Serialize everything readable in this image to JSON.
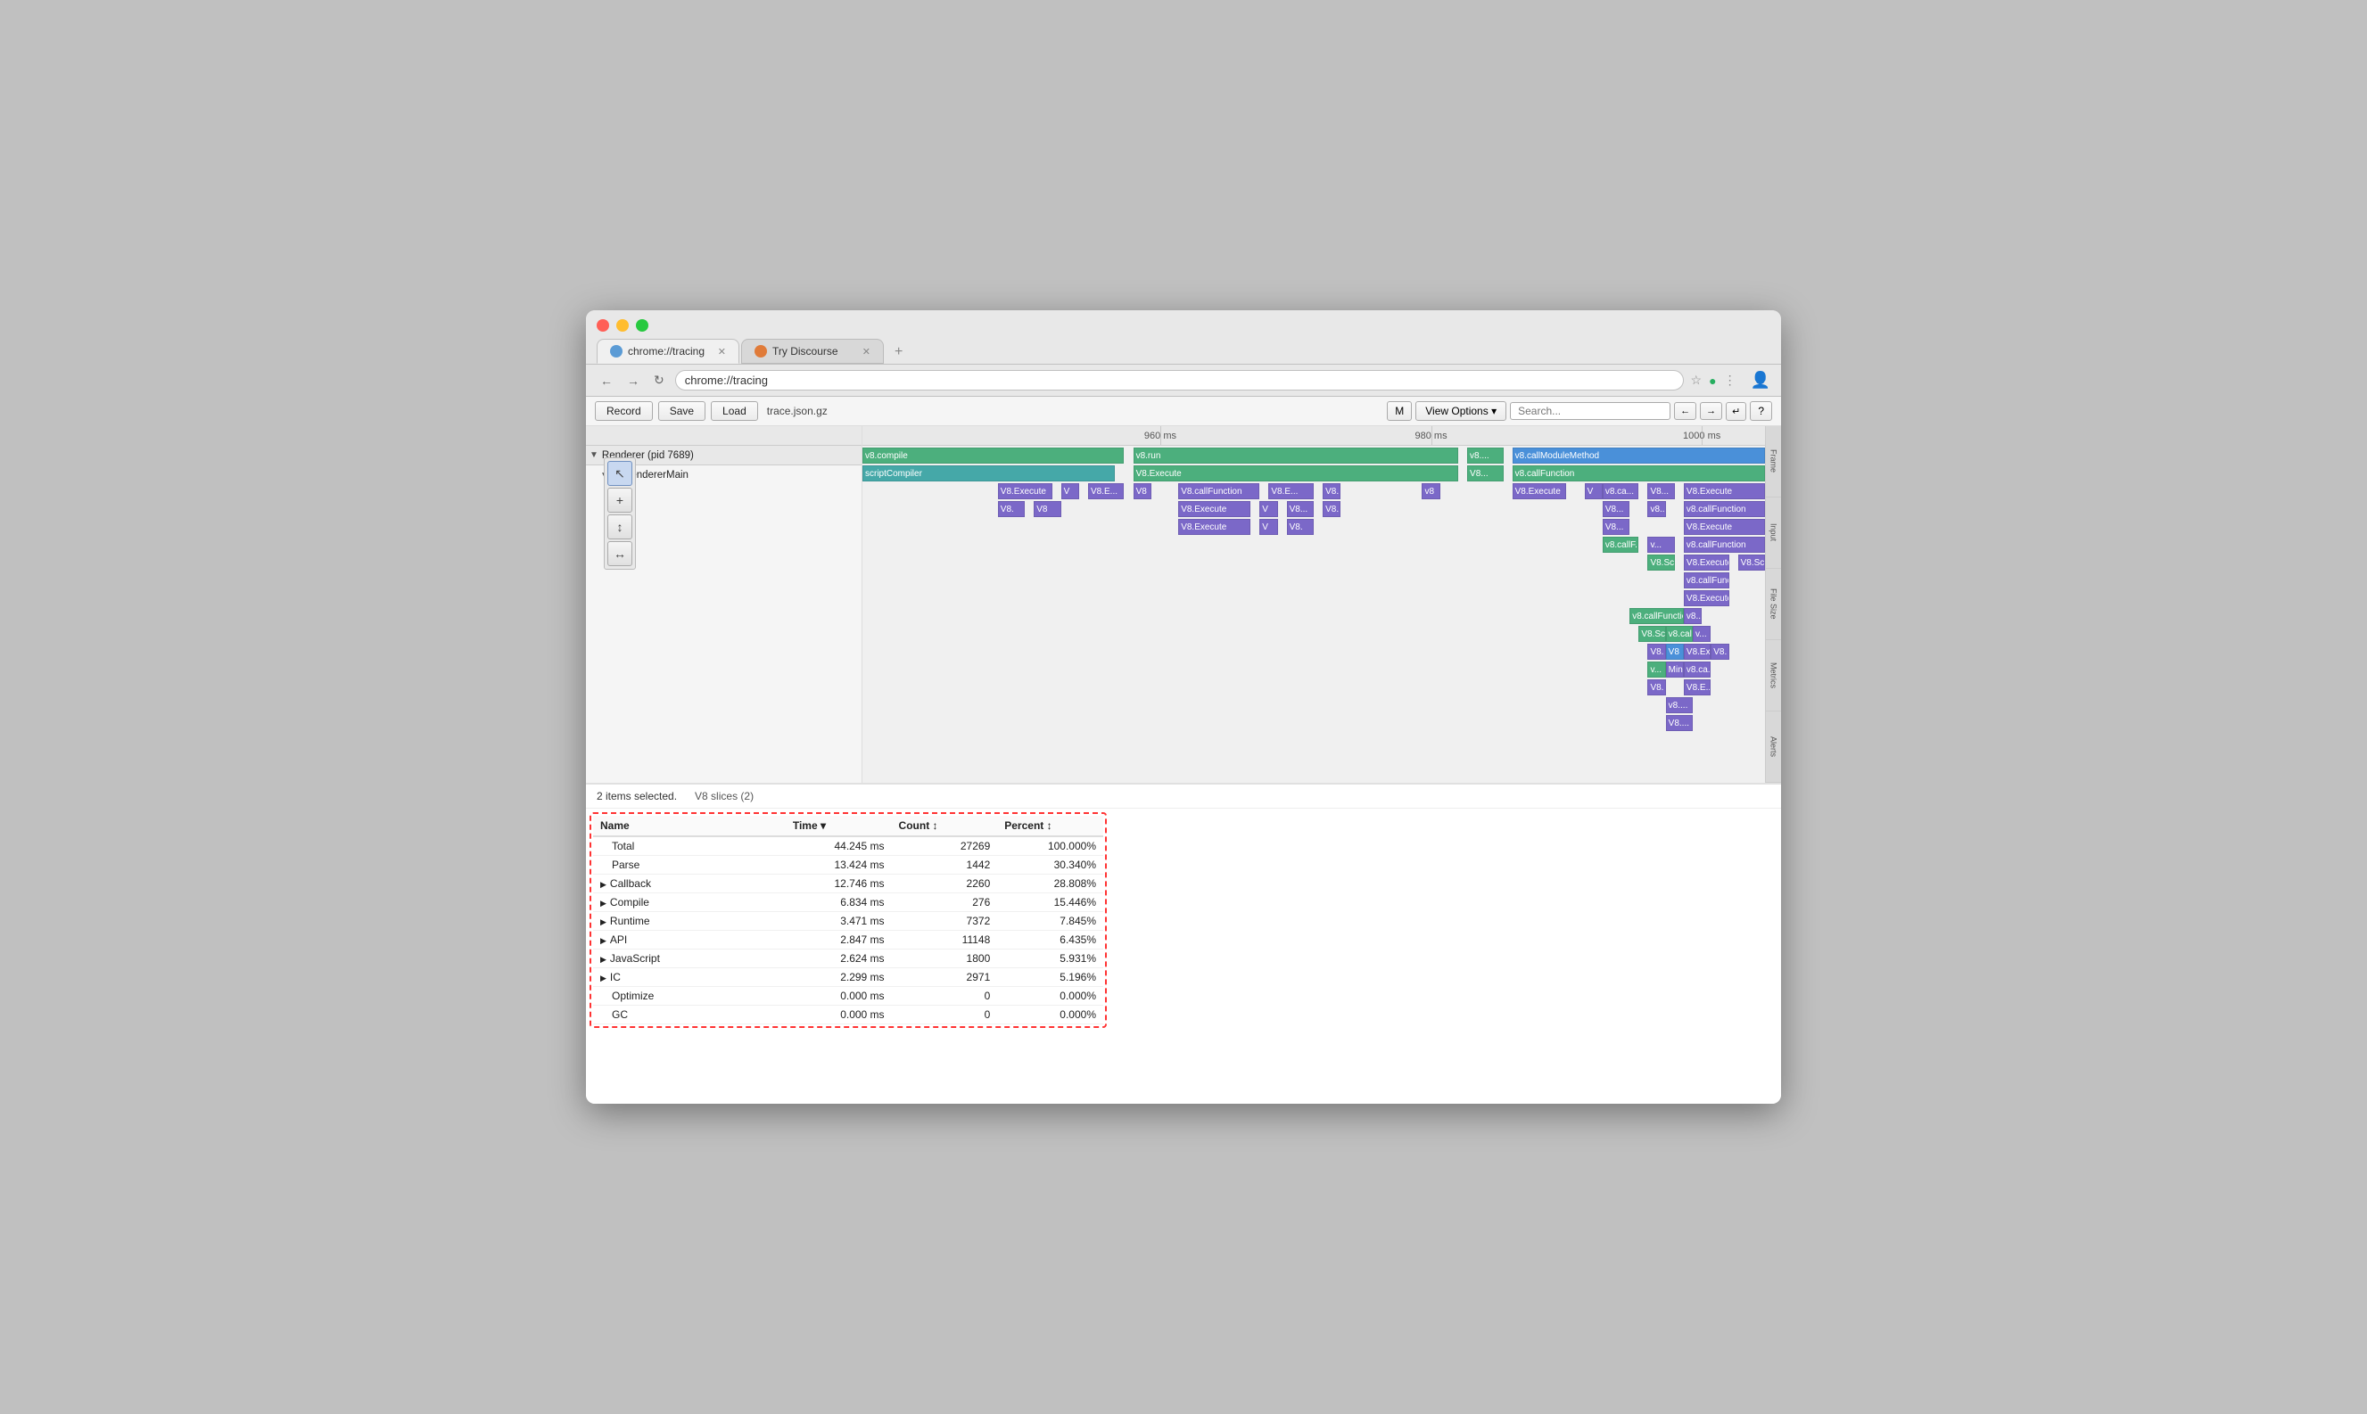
{
  "window": {
    "title": "chrome://tracing"
  },
  "tabs": [
    {
      "id": "tracing",
      "label": "chrome://tracing",
      "active": true,
      "icon": "tracing"
    },
    {
      "id": "discourse",
      "label": "Try Discourse",
      "active": false,
      "icon": "discourse"
    }
  ],
  "address_bar": {
    "url": "chrome://tracing"
  },
  "toolbar": {
    "record_label": "Record",
    "save_label": "Save",
    "load_label": "Load",
    "file_label": "trace.json.gz",
    "m_label": "M",
    "view_options_label": "View Options ▾",
    "help_label": "?"
  },
  "timeline": {
    "time_labels": [
      "960 ms",
      "980 ms",
      "1000 ms"
    ],
    "process_label": "Renderer (pid 7689)",
    "thread_label": "CrRendererMain"
  },
  "right_labels": [
    "Frame",
    "Input",
    "File Size",
    "Metrics",
    "Alerts"
  ],
  "tools": [
    "↖",
    "+",
    "↕",
    "↔"
  ],
  "bottom": {
    "selection_info": "2 items selected.",
    "slice_info": "V8 slices (2)",
    "columns": [
      {
        "key": "name",
        "label": "Name"
      },
      {
        "key": "time",
        "label": "Time ▾"
      },
      {
        "key": "count",
        "label": "Count ↕"
      },
      {
        "key": "percent",
        "label": "Percent ↕"
      }
    ],
    "rows": [
      {
        "name": "Total",
        "time": "44.245 ms",
        "count": "27269",
        "percent": "100.000%",
        "expandable": false
      },
      {
        "name": "Parse",
        "time": "13.424 ms",
        "count": "1442",
        "percent": "30.340%",
        "expandable": false
      },
      {
        "name": "Callback",
        "time": "12.746 ms",
        "count": "2260",
        "percent": "28.808%",
        "expandable": true
      },
      {
        "name": "Compile",
        "time": "6.834 ms",
        "count": "276",
        "percent": "15.446%",
        "expandable": true
      },
      {
        "name": "Runtime",
        "time": "3.471 ms",
        "count": "7372",
        "percent": "7.845%",
        "expandable": true
      },
      {
        "name": "API",
        "time": "2.847 ms",
        "count": "11148",
        "percent": "6.435%",
        "expandable": true
      },
      {
        "name": "JavaScript",
        "time": "2.624 ms",
        "count": "1800",
        "percent": "5.931%",
        "expandable": true
      },
      {
        "name": "IC",
        "time": "2.299 ms",
        "count": "2971",
        "percent": "5.196%",
        "expandable": true
      },
      {
        "name": "Optimize",
        "time": "0.000 ms",
        "count": "0",
        "percent": "0.000%",
        "expandable": false
      },
      {
        "name": "GC",
        "time": "0.000 ms",
        "count": "0",
        "percent": "0.000%",
        "expandable": false
      }
    ]
  }
}
